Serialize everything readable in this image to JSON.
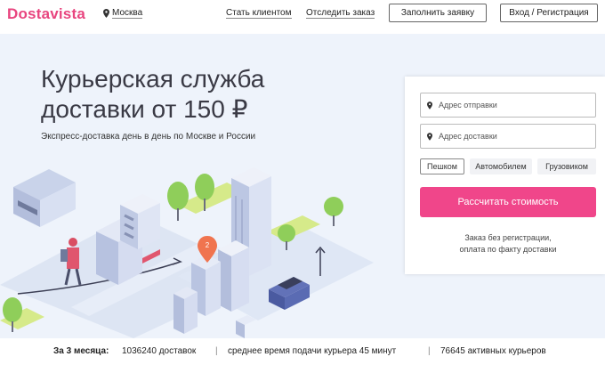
{
  "header": {
    "logo": "Dostavista",
    "city": "Москва",
    "links": [
      "Стать клиентом",
      "Отследить заказ"
    ],
    "fill_request": "Заполнить заявку",
    "login": "Вход / Регистрация"
  },
  "hero": {
    "title_line1": "Курьерская служба",
    "title_line2": "доставки от 150 ₽",
    "subtitle": "Экспресс-доставка день в день по Москве и России"
  },
  "form": {
    "from_placeholder": "Адрес отправки",
    "to_placeholder": "Адрес доставки",
    "modes": [
      "Пешком",
      "Автомобилем",
      "Грузовиком"
    ],
    "active_mode": "Пешком",
    "submit": "Рассчитать стоимость",
    "note_line1": "Заказ без регистрации,",
    "note_line2": "оплата по факту доставки"
  },
  "stats": {
    "lead": "За 3 месяца:",
    "deliveries": "1036240 доставок",
    "avg_time": "среднее время подачи курьера 45 минут",
    "couriers": "76645 активных курьеров"
  },
  "colors": {
    "brand": "#e8457f",
    "button": "#f0468a",
    "hero_bg": "#eef3fb"
  }
}
